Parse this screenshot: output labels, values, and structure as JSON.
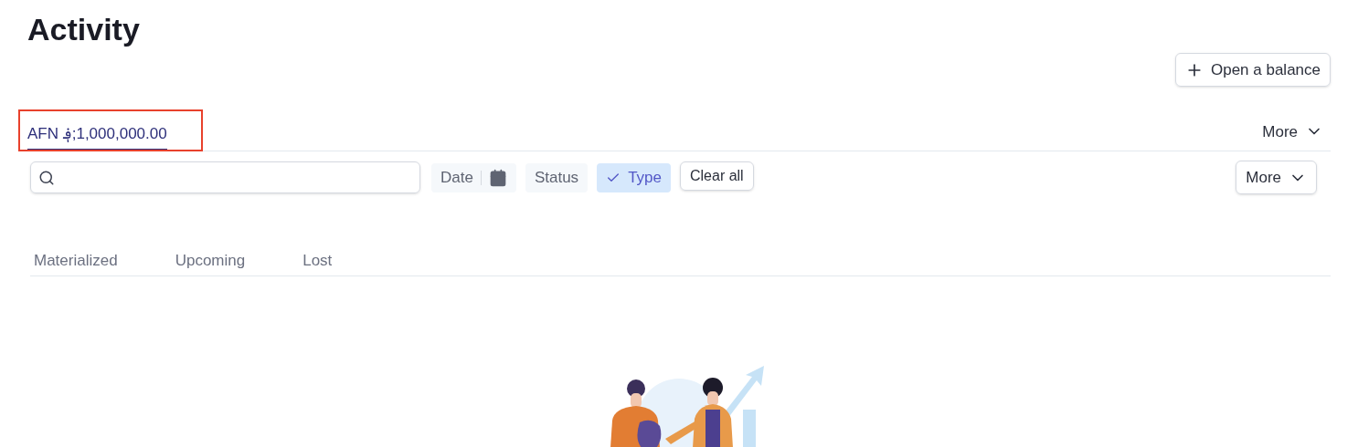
{
  "title": "Activity",
  "open_balance_button": {
    "label": "Open a balance"
  },
  "balance_tabs": [
    {
      "label": "AFN ؋;1,000,000.00",
      "selected": true
    }
  ],
  "balance_more": {
    "label": "More"
  },
  "filters": [
    {
      "kind": "date",
      "label": "Date",
      "selected": false
    },
    {
      "kind": "plain",
      "label": "Status",
      "selected": false
    },
    {
      "kind": "plain",
      "label": "Type",
      "selected": true
    }
  ],
  "clear_all": {
    "label": "Clear all"
  },
  "filter_more": {
    "label": "More"
  },
  "activity_tabs": [
    {
      "label": "Materialized",
      "selected": false
    },
    {
      "label": "Upcoming",
      "selected": false
    },
    {
      "label": "Lost",
      "selected": false
    }
  ]
}
